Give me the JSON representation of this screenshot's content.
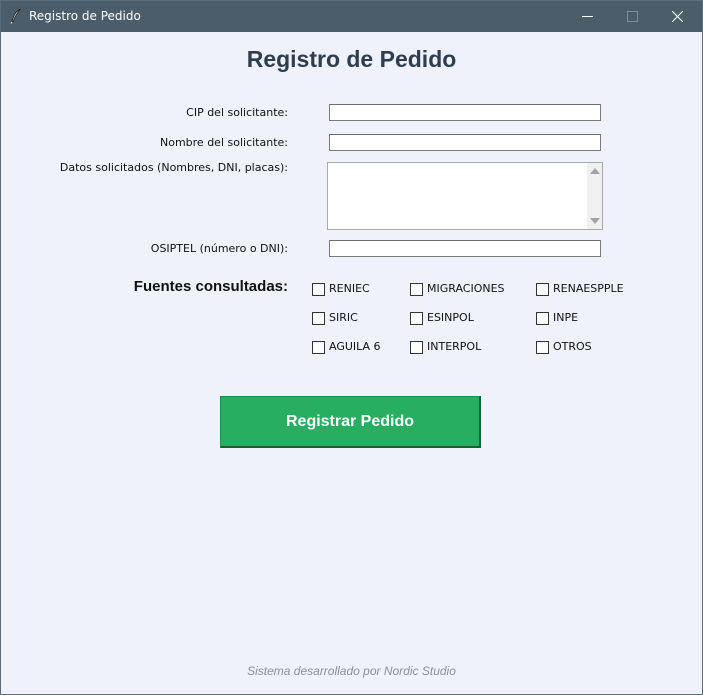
{
  "window": {
    "title": "Registro de Pedido",
    "app_icon": "feather-icon"
  },
  "form": {
    "heading": "Registro de Pedido",
    "fields": {
      "cip": {
        "label": "CIP del solicitante:",
        "value": ""
      },
      "nombre": {
        "label": "Nombre del solicitante:",
        "value": ""
      },
      "datos": {
        "label": "Datos solicitados (Nombres, DNI, placas):",
        "value": ""
      },
      "osiptel": {
        "label": "OSIPTEL (número o DNI):",
        "value": ""
      }
    },
    "fuentes_label": "Fuentes consultadas:",
    "fuentes": [
      {
        "label": "RENIEC",
        "checked": false
      },
      {
        "label": "MIGRACIONES",
        "checked": false
      },
      {
        "label": "RENAESPPLE",
        "checked": false
      },
      {
        "label": "SIRIC",
        "checked": false
      },
      {
        "label": "ESINPOL",
        "checked": false
      },
      {
        "label": "INPE",
        "checked": false
      },
      {
        "label": "AGUILA 6",
        "checked": false
      },
      {
        "label": "INTERPOL",
        "checked": false
      },
      {
        "label": "OTROS",
        "checked": false
      }
    ],
    "submit_label": "Registrar Pedido"
  },
  "footer": "Sistema desarrollado por Nordic Studio",
  "colors": {
    "titlebar": "#4b5d6b",
    "background": "#f0f2fb",
    "heading": "#2c3e50",
    "button": "#27ae60"
  }
}
